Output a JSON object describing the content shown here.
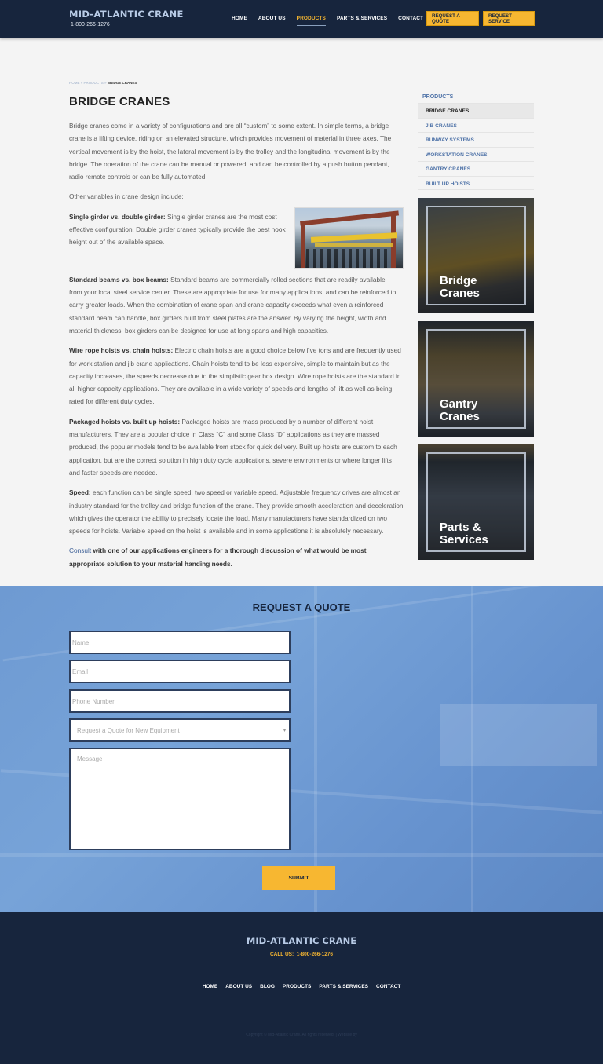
{
  "header": {
    "brand": "MID-ATLANTIC CRANE",
    "phone": "1-800-266-1276",
    "nav": [
      {
        "label": "HOME",
        "active": false
      },
      {
        "label": "ABOUT US",
        "active": false
      },
      {
        "label": "PRODUCTS",
        "active": true
      },
      {
        "label": "PARTS & SERVICES",
        "active": false
      },
      {
        "label": "CONTACT",
        "active": false
      }
    ],
    "request_quote": "REQUEST A QUOTE",
    "request_service": "REQUEST SERVICE"
  },
  "breadcrumb": {
    "home": "HOME",
    "sep": " » ",
    "products": "PRODUCTS",
    "current": "BRIDGE CRANES"
  },
  "page": {
    "title": "BRIDGE CRANES",
    "intro": "Bridge cranes come in a variety of configurations and are all “custom” to some extent. In simple terms, a bridge crane is a lifting device, riding on an elevated structure, which provides movement of material in three axes. The vertical movement is by the hoist, the lateral movement is by the trolley and the longitudinal movement is by the bridge. The operation of the crane can be manual or powered, and can be controlled by a push button pendant, radio remote controls or can be fully automated.",
    "variables_intro": "Other variables in crane design include:",
    "sections": [
      {
        "heading": "Single girder vs. double girder:",
        "text": " Single girder cranes are the most cost effective configuration. Double girder cranes typically provide the best hook height out of the available space."
      },
      {
        "heading": "Standard beams vs. box beams:",
        "text": " Standard beams are commercially rolled sections that are readily available\nfrom your local steel service center. These are appropriate for use for many applications, and can be reinforced to carry greater loads. When the combination of crane span and crane capacity exceeds what even a reinforced standard beam can handle, box girders built from steel plates are the answer. By varying the height, width and material thickness, box girders can be designed for use at long spans and high capacities."
      },
      {
        "heading": "Wire rope hoists vs. chain hoists:",
        "text": " Electric chain hoists are a good choice below five tons and are frequently used for work station and jib crane applications. Chain hoists tend to be less expensive, simple to maintain but as the capacity increases, the speeds decrease due to the simplistic gear box design. Wire rope hoists are the standard in all higher capacity applications. They are available in a wide variety of speeds and lengths of lift as well as being rated for different duty cycles."
      },
      {
        "heading": "Packaged hoists vs. built up hoists:",
        "text": " Packaged hoists are mass produced by a number of different hoist manufacturers. They are a popular choice in Class “C” and some Class “D” applications as they are massed produced, the popular models tend to be available from stock for quick delivery. Built up hoists are custom to each application, but are the correct solution in high duty cycle applications, severe environments or where longer lifts and faster speeds are needed."
      },
      {
        "heading": "Speed:",
        "text": " each function can be single speed, two speed or variable speed. Adjustable frequency drives are almost an industry standard for the trolley and bridge function of the crane. They provide smooth acceleration and deceleration which gives the operator the ability to precisely locate the load. Many manufacturers have standardized on two speeds for hoists. Variable speed on the hoist is available and in some applications it is absolutely necessary."
      }
    ],
    "consult_link": "Consult",
    "consult_text": " with one of our applications engineers for a thorough discussion of what would be most appropriate solution to your material handing needs."
  },
  "sidebar": {
    "heading": "PRODUCTS",
    "items": [
      {
        "label": "BRIDGE CRANES",
        "active": true
      },
      {
        "label": "JIB CRANES",
        "active": false
      },
      {
        "label": "RUNWAY SYSTEMS",
        "active": false
      },
      {
        "label": "WORKSTATION CRANES",
        "active": false
      },
      {
        "label": "GANTRY CRANES",
        "active": false
      },
      {
        "label": "BUILT UP HOISTS",
        "active": false
      }
    ],
    "tiles": [
      {
        "line1": "Bridge",
        "line2": "Cranes"
      },
      {
        "line1": "Gantry",
        "line2": "Cranes"
      },
      {
        "line1": "Parts &",
        "line2": "Services"
      }
    ]
  },
  "quote_form": {
    "title": "REQUEST A QUOTE",
    "name_placeholder": "Name",
    "email_placeholder": "Email",
    "phone_placeholder": "Phone Number",
    "select_value": "Request a Quote for New Equipment",
    "message_placeholder": "Message",
    "submit": "SUBMIT"
  },
  "footer": {
    "brand": "MID-ATLANTIC CRANE",
    "call_label": "CALL US:",
    "phone": "1-800-266-1276",
    "nav": [
      "HOME",
      "ABOUT US",
      "BLOG",
      "PRODUCTS",
      "PARTS & SERVICES",
      "CONTACT"
    ],
    "copyright": "Copyright © Mid-Atlantic Crane. All rights reserved. | Website by"
  },
  "colors": {
    "navy": "#17253d",
    "accent_yellow": "#f7b731",
    "link_blue": "#4f73a8",
    "quote_bg": "#6e9ad2"
  }
}
